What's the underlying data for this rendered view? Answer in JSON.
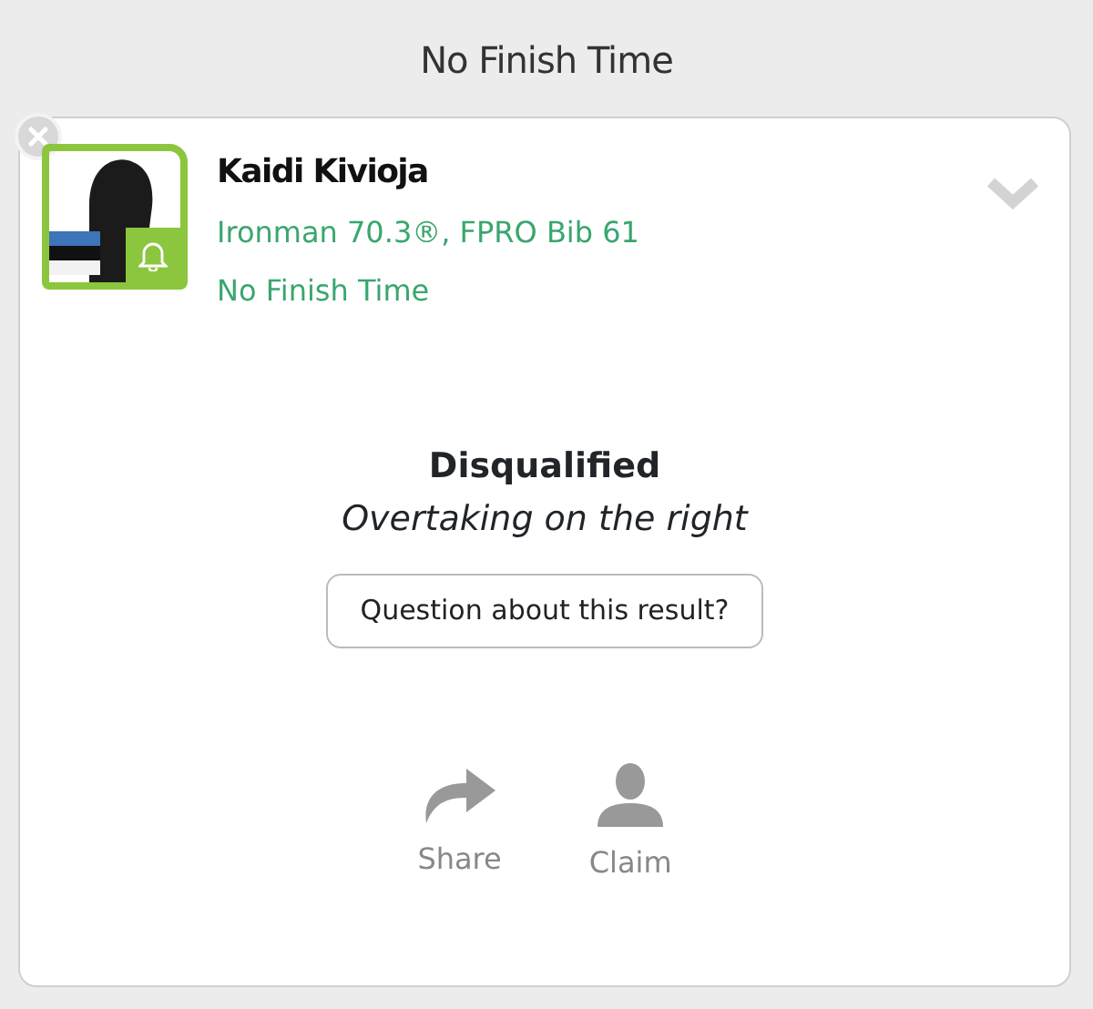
{
  "header": {
    "title": "No Finish Time"
  },
  "result": {
    "name": "Kaidi Kivioja",
    "event": "Ironman 70.3®, FPRO Bib 61",
    "status": "No Finish Time",
    "expanded": false
  },
  "verdict": {
    "title": "Disqualified",
    "reason": "Overtaking on the right",
    "question_button": "Question about this result?"
  },
  "actions": [
    {
      "kind": "share",
      "label": "Share"
    },
    {
      "kind": "claim",
      "label": "Claim"
    }
  ]
}
